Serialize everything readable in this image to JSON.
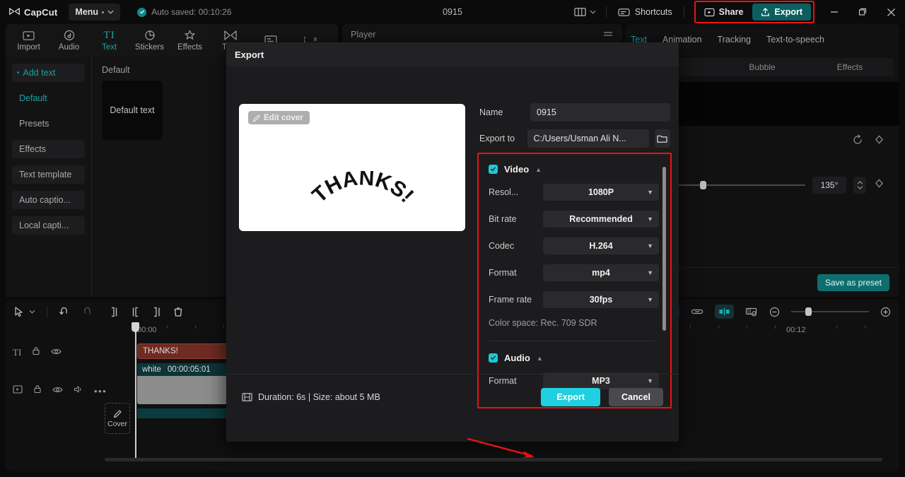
{
  "titlebar": {
    "brand": "CapCut",
    "menu_label": "Menu",
    "autosave": "Auto saved: 00:10:26",
    "project_title": "0915",
    "shortcuts_label": "Shortcuts",
    "share_label": "Share",
    "export_label": "Export",
    "icons": {
      "logo": "capcut-logo-icon",
      "check": "check-circle-icon",
      "layout": "layout-icon",
      "layout_caret": "chevron-down-icon",
      "shortcuts": "keyboard-icon",
      "share": "share-icon",
      "export": "upload-icon",
      "minimize": "minimize-icon",
      "maximize": "maximize-icon",
      "close": "close-icon"
    },
    "accent_teal": "#17a2a2",
    "highlight_red": "#ee1111"
  },
  "tool_tabs": [
    {
      "label": "Import",
      "icon": "media-import-icon",
      "active": false
    },
    {
      "label": "Audio",
      "icon": "music-note-icon",
      "active": false
    },
    {
      "label": "Text",
      "icon": "text-TI-icon",
      "active": true
    },
    {
      "label": "Stickers",
      "icon": "sticker-icon",
      "active": false
    },
    {
      "label": "Effects",
      "icon": "sparkle-star-icon",
      "active": false
    },
    {
      "label": "Tran",
      "icon": "transition-icon",
      "active": false
    },
    {
      "label": "",
      "icon": "caption-icon",
      "active": false
    },
    {
      "label": "",
      "icon": "filter-icon",
      "active": false
    }
  ],
  "left_sidebar": {
    "items": [
      {
        "label": "Add text",
        "style": "accent-box"
      },
      {
        "label": "Default",
        "style": "selected"
      },
      {
        "label": "Presets",
        "style": "plain"
      },
      {
        "label": "Effects",
        "style": "box"
      },
      {
        "label": "Text template",
        "style": "box"
      },
      {
        "label": "Auto captio...",
        "style": "box"
      },
      {
        "label": "Local capti...",
        "style": "box"
      }
    ],
    "group_label": "Default",
    "preset_card_label": "Default text"
  },
  "player": {
    "label": "Player",
    "menu_icon": "hamburger-icon"
  },
  "right_panel": {
    "tabs": [
      {
        "label": "Text",
        "active": true
      },
      {
        "label": "Animation",
        "active": false
      },
      {
        "label": "Tracking",
        "active": false
      },
      {
        "label": "Text-to-speech",
        "active": false
      }
    ],
    "subtabs": [
      {
        "label": "",
        "active": true
      },
      {
        "label": "Bubble",
        "active": false
      },
      {
        "label": "Effects",
        "active": false
      }
    ],
    "reset_icon": "reset-icon",
    "keyframe_icon": "keyframe-diamond-icon",
    "angle_value": "135°",
    "stepper_icon": "stepper-up-down-icon",
    "save_preset_label": "Save as preset"
  },
  "timeline": {
    "tools": [
      {
        "icon": "cursor-select-icon",
        "name": "select-tool"
      },
      {
        "icon": "chevron-down-icon",
        "name": "select-tool-dropdown"
      },
      {
        "icon": "undo-icon",
        "name": "undo-button"
      },
      {
        "icon": "redo-icon",
        "name": "redo-button"
      },
      {
        "icon": "split-icon",
        "name": "split-button"
      },
      {
        "icon": "trim-left-icon",
        "name": "trim-left-button"
      },
      {
        "icon": "trim-right-icon",
        "name": "trim-right-button"
      },
      {
        "icon": "trash-icon",
        "name": "delete-button"
      }
    ],
    "right_tools": [
      {
        "icon": "auto-adjust-icon",
        "name": "smart-tool-button"
      },
      {
        "icon": "link-icon",
        "name": "link-button"
      },
      {
        "icon": "mirror-icon",
        "name": "mirror-button"
      },
      {
        "icon": "fit-timeline-icon",
        "name": "fit-timeline-button"
      },
      {
        "icon": "zoom-out-icon",
        "name": "zoom-out-button"
      },
      {
        "icon": "zoom-in-icon",
        "name": "zoom-in-button"
      }
    ],
    "ruler_start": "00:00",
    "ruler_mark": "00:12",
    "cover_label": "Cover",
    "cover_icon": "pencil-icon",
    "text_track": {
      "icons": [
        "text-TI-icon",
        "lock-icon",
        "eye-icon"
      ],
      "clip_label": "THANKS!"
    },
    "video_track": {
      "icons": [
        "video-icon",
        "lock-icon",
        "eye-icon",
        "volume-icon",
        "more-icon"
      ],
      "clip_name": "white",
      "clip_duration": "00:00:05:01"
    }
  },
  "export_dialog": {
    "title": "Export",
    "edit_cover_label": "Edit cover",
    "edit_cover_icon": "pencil-icon",
    "preview_text": "THANKS!",
    "name_label": "Name",
    "name_value": "0915",
    "export_to_label": "Export to",
    "export_to_value": "C:/Users/Usman Ali N...",
    "folder_icon": "folder-icon",
    "video_section": {
      "title": "Video",
      "checked": true,
      "collapse_icon": "chevron-up-icon",
      "rows": [
        {
          "label": "Resol...",
          "value": "1080P"
        },
        {
          "label": "Bit rate",
          "value": "Recommended"
        },
        {
          "label": "Codec",
          "value": "H.264"
        },
        {
          "label": "Format",
          "value": "mp4"
        },
        {
          "label": "Frame rate",
          "value": "30fps"
        }
      ],
      "color_space": "Color space: Rec. 709 SDR"
    },
    "audio_section": {
      "title": "Audio",
      "checked": true,
      "collapse_icon": "chevron-up-icon",
      "rows": [
        {
          "label": "Format",
          "value": "MP3"
        }
      ]
    },
    "duration_icon": "film-icon",
    "duration_text": "Duration: 6s | Size: about 5 MB",
    "export_button": "Export",
    "cancel_button": "Cancel",
    "highlight_color": "#ee1111",
    "export_button_color": "#20d0e0"
  }
}
